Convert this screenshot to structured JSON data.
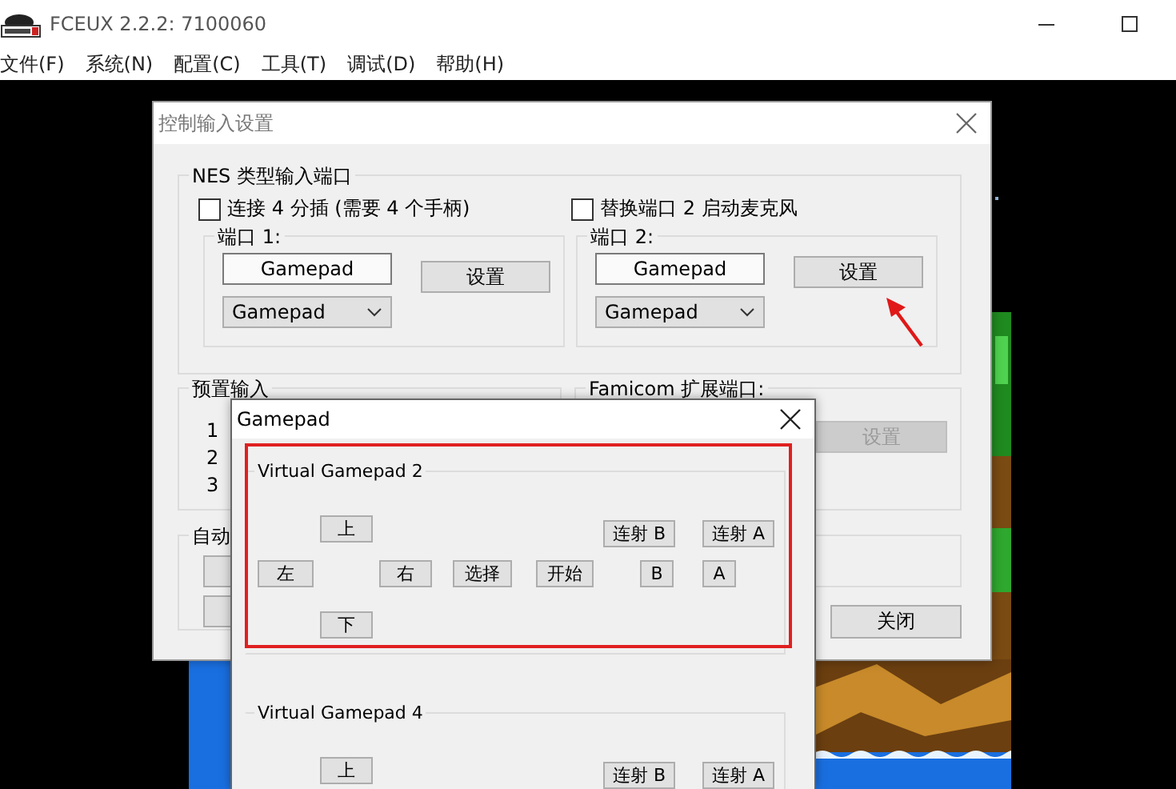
{
  "window": {
    "title": "FCEUX 2.2.2: 7100060"
  },
  "menu": [
    "文件(F)",
    "系统(N)",
    "配置(C)",
    "工具(T)",
    "调试(D)",
    "帮助(H)"
  ],
  "input_dialog": {
    "title": "控制输入设置",
    "nes_ports": {
      "title": "NES 类型输入端口",
      "options": [
        {
          "label": "连接 4 分插 (需要 4 个手柄)",
          "checked": false
        },
        {
          "label": "替换端口 2 启动麦克风",
          "checked": false
        }
      ],
      "ports": [
        {
          "title": "端口 1:",
          "device": "Gamepad",
          "setup": "设置",
          "select": "Gamepad"
        },
        {
          "title": "端口 2:",
          "device": "Gamepad",
          "setup": "设置",
          "select": "Gamepad"
        }
      ]
    },
    "presets": {
      "title": "预置输入",
      "items": [
        "1",
        "2",
        "3"
      ]
    },
    "famicom": {
      "title": "Famicom 扩展端口:",
      "setup": {
        "label": "设置",
        "disabled": true
      }
    },
    "auto": {
      "title": "自动"
    },
    "close": "关闭"
  },
  "gamepad_dialog": {
    "title": "Gamepad",
    "groups": [
      {
        "title": "Virtual Gamepad 2",
        "buttons": [
          "上",
          "连射 B",
          "连射 A",
          "左",
          "右",
          "选择",
          "开始",
          "B",
          "A",
          "下"
        ]
      },
      {
        "title": "Virtual Gamepad 4",
        "buttons": [
          "上",
          "连射 B",
          "连射 A"
        ]
      }
    ]
  }
}
